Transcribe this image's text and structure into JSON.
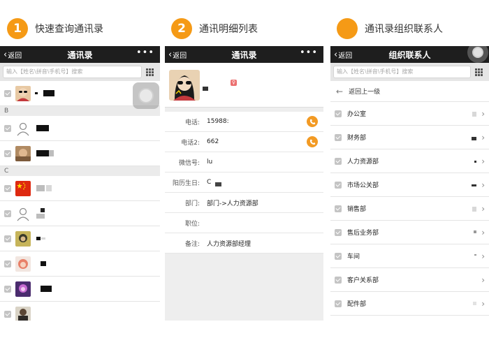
{
  "steps": [
    {
      "num": "1",
      "title": "快速查询通讯录"
    },
    {
      "num": "2",
      "title": "通讯明细列表"
    },
    {
      "num": "",
      "title": "通讯录组织联系人"
    }
  ],
  "panel1": {
    "back_label": "返回",
    "title": "通讯录",
    "more": "•••",
    "search_placeholder": "输入【姓名\\拼音\\手机号】搜索",
    "sections": [
      "B",
      "C"
    ]
  },
  "panel2": {
    "back_label": "返回",
    "title": "通讯录",
    "more": "•••",
    "fields": [
      {
        "label": "电话:",
        "value": "15988:"
      },
      {
        "label": "电话2:",
        "value": "662"
      },
      {
        "label": "微信号:",
        "value": "lu"
      },
      {
        "label": "阳历生日:",
        "value": "C"
      },
      {
        "label": "部门:",
        "value": "部门->人力资源部"
      },
      {
        "label": "职位:",
        "value": ""
      },
      {
        "label": "备注:",
        "value": "人力资源部经理"
      }
    ]
  },
  "panel3": {
    "back_label": "返回",
    "title": "组织联系人",
    "search_placeholder": "输入【姓名\\拼音\\手机号】搜索",
    "up_label": "返回上一级",
    "departments": [
      "办公室",
      "财务部",
      "人力资源部",
      "市场公关部",
      "销售部",
      "售后业务部",
      "车间",
      "客户关系部",
      "配件部"
    ]
  },
  "colors": {
    "accent": "#f59a16",
    "nav_bg": "#1e1e1e"
  }
}
